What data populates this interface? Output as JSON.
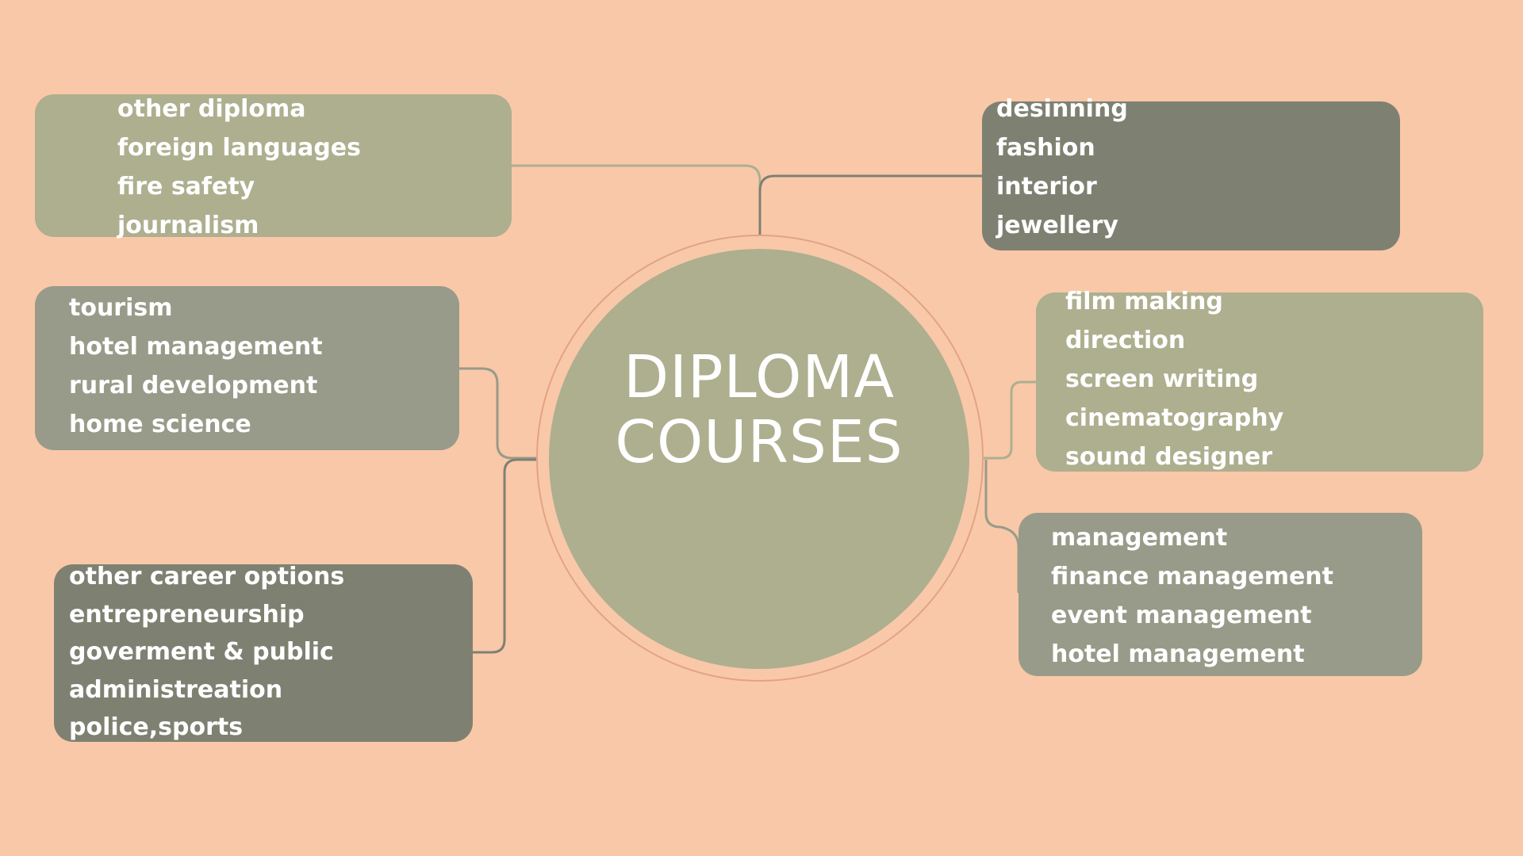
{
  "center": {
    "title_line1": "DIPLOMA",
    "title_line2": "COURSES"
  },
  "colors": {
    "background": "#f9c8a8",
    "box_light": "#adaf8f",
    "box_mid": "#989b89",
    "box_dark": "#7e8172",
    "hub_ring": "#e2a385"
  },
  "branches": {
    "top_left": [
      "other diploma",
      "foreign languages",
      "fire safety",
      "journalism"
    ],
    "middle_left": [
      "tourism",
      "hotel management",
      "rural development",
      "home science"
    ],
    "bottom_left": [
      "other career options",
      "entrepreneurship",
      "goverment & public",
      "administreation",
      "police,sports"
    ],
    "top_right": [
      "desinning",
      "fashion",
      "interior",
      "jewellery"
    ],
    "middle_right": [
      "film making",
      "direction",
      "screen writing",
      "cinematography",
      "sound designer"
    ],
    "bottom_right": [
      "management",
      "finance management",
      "event management",
      "hotel management"
    ]
  }
}
